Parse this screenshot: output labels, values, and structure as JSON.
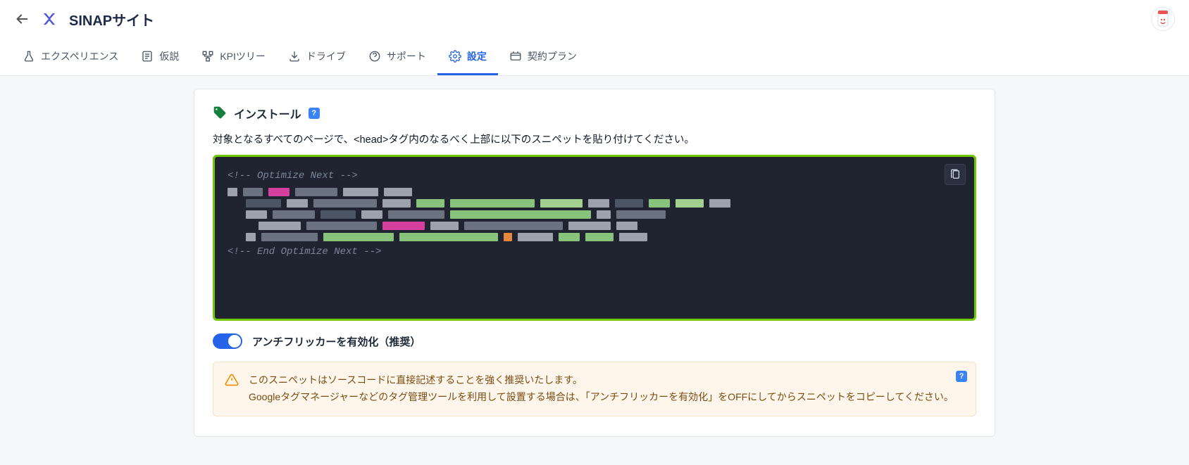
{
  "header": {
    "site_title": "SINAPサイト"
  },
  "tabs": [
    {
      "label": "エクスペリエンス"
    },
    {
      "label": "仮説"
    },
    {
      "label": "KPIツリー"
    },
    {
      "label": "ドライブ"
    },
    {
      "label": "サポート"
    },
    {
      "label": "設定",
      "active": true
    },
    {
      "label": "契約プラン"
    }
  ],
  "install": {
    "title": "インストール",
    "help": "?",
    "description": "対象となるすべてのページで、<head>タグ内のなるべく上部に以下のスニペットを貼り付けてください。",
    "code_comment_start": "<!-- Optimize Next -->",
    "code_comment_end": "<!-- End Optimize Next -->"
  },
  "toggle": {
    "label": "アンチフリッカーを有効化（推奨）",
    "on": true
  },
  "alert": {
    "line1": "このスニペットはソースコードに直接記述することを強く推奨いたします。",
    "line2": "Googleタグマネージャーなどのタグ管理ツールを利用して設置する場合は、「アンチフリッカーを有効化」をOFFにしてからスニペットをコピーしてください。",
    "help": "?"
  }
}
